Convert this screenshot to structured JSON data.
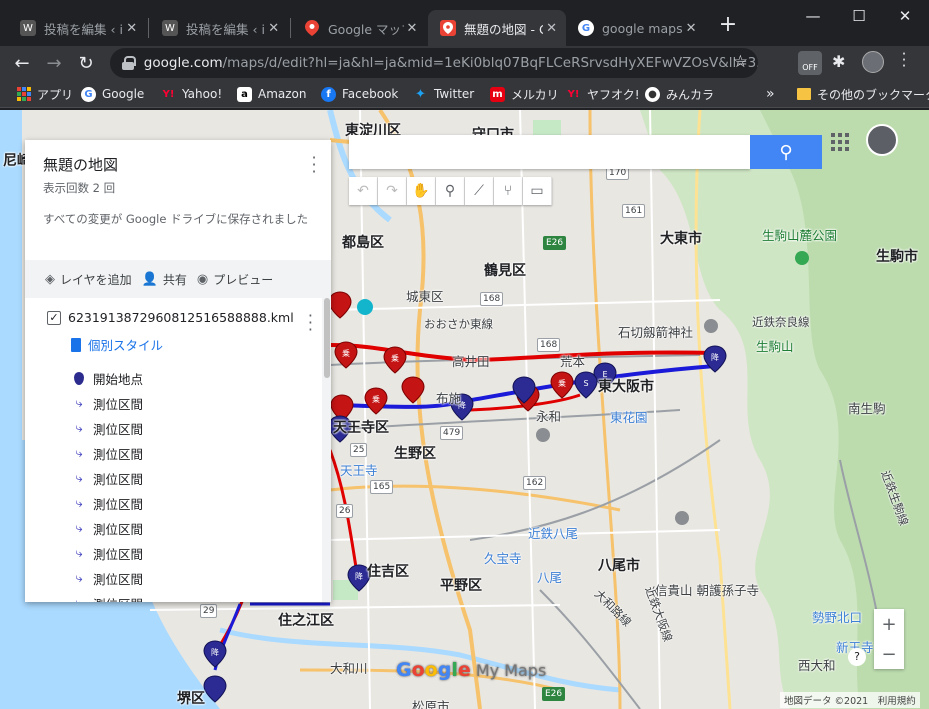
{
  "tabs": [
    {
      "title": "投稿を編集 ‹ iF",
      "favicon": "wordpress-icon",
      "active": false
    },
    {
      "title": "投稿を編集 ‹ iF",
      "favicon": "wordpress-icon",
      "active": false
    },
    {
      "title": "Google マップ",
      "favicon": "google-maps-icon",
      "active": false
    },
    {
      "title": "無題の地図 - G",
      "favicon": "my-maps-icon",
      "active": true
    },
    {
      "title": "google maps",
      "favicon": "google-icon",
      "active": false
    }
  ],
  "toolbar": {
    "url_host": "google.com",
    "url_rest": "/maps/d/edit?hl=ja&hl=ja&mid=1eKi0blq07BqFLCeRSrvsdHyXEFwVZOsV&ll=3..."
  },
  "bookmarks": [
    {
      "label": "アプリ",
      "icon": "apps-grid-icon",
      "color": "#ea4335"
    },
    {
      "label": "Google",
      "icon": "google-icon",
      "color": "#4285f4"
    },
    {
      "label": "Yahoo!",
      "icon": "yahoo-icon",
      "color": "#d50000"
    },
    {
      "label": "Amazon",
      "icon": "amazon-icon",
      "color": "#232f3e"
    },
    {
      "label": "Facebook",
      "icon": "facebook-icon",
      "color": "#1877f2"
    },
    {
      "label": "Twitter",
      "icon": "twitter-icon",
      "color": "#1da1f2"
    },
    {
      "label": "メルカリ",
      "icon": "mercari-icon",
      "color": "#e60012"
    },
    {
      "label": "ヤフオク!",
      "icon": "yahoo-auction-icon",
      "color": "#d50000"
    },
    {
      "label": "みんカラ",
      "icon": "minkara-icon",
      "color": "#2b2b2b"
    }
  ],
  "bookmarks_other": "その他のブックマーク",
  "panel": {
    "title": "無題の地図",
    "views": "表示回数 2 回",
    "saved": "すべての変更が Google ドライブに保存されました",
    "add_layer": "レイヤを追加",
    "share": "共有",
    "preview": "プレビュー",
    "layer_name": "6231913872960812516588888.kml",
    "style": "個別スタイル",
    "items": [
      "開始地点",
      "測位区間",
      "測位区間",
      "測位区間",
      "測位区間",
      "測位区間",
      "測位区間",
      "測位区間",
      "測位区間",
      "測位区間"
    ]
  },
  "map_labels": [
    {
      "text": "東淀川区",
      "cls": "big"
    },
    {
      "text": "守口市",
      "cls": "big"
    },
    {
      "text": "都島区",
      "cls": "big"
    },
    {
      "text": "鶴見区",
      "cls": "big"
    },
    {
      "text": "大東市",
      "cls": "big"
    },
    {
      "text": "生駒山麓公園",
      "cls": "green"
    },
    {
      "text": "生駒市",
      "cls": "big"
    },
    {
      "text": "城東区",
      "cls": ""
    },
    {
      "text": "おおさか東線",
      "cls": "small"
    },
    {
      "text": "石切劔箭神社",
      "cls": ""
    },
    {
      "text": "近鉄奈良線",
      "cls": "small"
    },
    {
      "text": "生駒山",
      "cls": "green"
    },
    {
      "text": "高井田",
      "cls": ""
    },
    {
      "text": "荒本",
      "cls": ""
    },
    {
      "text": "東大阪市",
      "cls": "big"
    },
    {
      "text": "布施",
      "cls": ""
    },
    {
      "text": "永和",
      "cls": ""
    },
    {
      "text": "東花園",
      "cls": "blue"
    },
    {
      "text": "南生駒",
      "cls": ""
    },
    {
      "text": "天王寺区",
      "cls": "big"
    },
    {
      "text": "生野区",
      "cls": "big"
    },
    {
      "text": "天王寺",
      "cls": "blue"
    },
    {
      "text": "近鉄八尾",
      "cls": "blue"
    },
    {
      "text": "久宝寺",
      "cls": "blue"
    },
    {
      "text": "八尾市",
      "cls": "big"
    },
    {
      "text": "住吉区",
      "cls": "big"
    },
    {
      "text": "平野区",
      "cls": "big"
    },
    {
      "text": "八尾",
      "cls": "blue"
    },
    {
      "text": "信貴山 朝護孫子寺",
      "cls": ""
    },
    {
      "text": "勢野北口",
      "cls": "blue"
    },
    {
      "text": "新王寺",
      "cls": "blue"
    },
    {
      "text": "西大和",
      "cls": ""
    },
    {
      "text": "住之江区",
      "cls": "big"
    },
    {
      "text": "堺区",
      "cls": "big"
    },
    {
      "text": "大和川",
      "cls": ""
    },
    {
      "text": "松原市",
      "cls": ""
    },
    {
      "text": "近鉄生駒線",
      "cls": "small"
    },
    {
      "text": "近鉄大阪線",
      "cls": "small"
    },
    {
      "text": "大和路線",
      "cls": "small"
    },
    {
      "text": "尼崎",
      "cls": "big"
    }
  ],
  "shields": [
    "170",
    "161",
    "E26",
    "168",
    "168",
    "479",
    "25",
    "165",
    "162",
    "26",
    "29",
    "E26"
  ],
  "logo": {
    "g": [
      "G",
      "o",
      "o",
      "g",
      "l",
      "e"
    ],
    "suffix": " My Maps"
  },
  "attribution": "地図データ ©2021　利用規約",
  "colors": {
    "route_red": "#e00000",
    "route_blue": "#1a1ad8",
    "pin_red": "#c41414",
    "pin_blue": "#2b2b93",
    "search_button": "#4285f4"
  }
}
